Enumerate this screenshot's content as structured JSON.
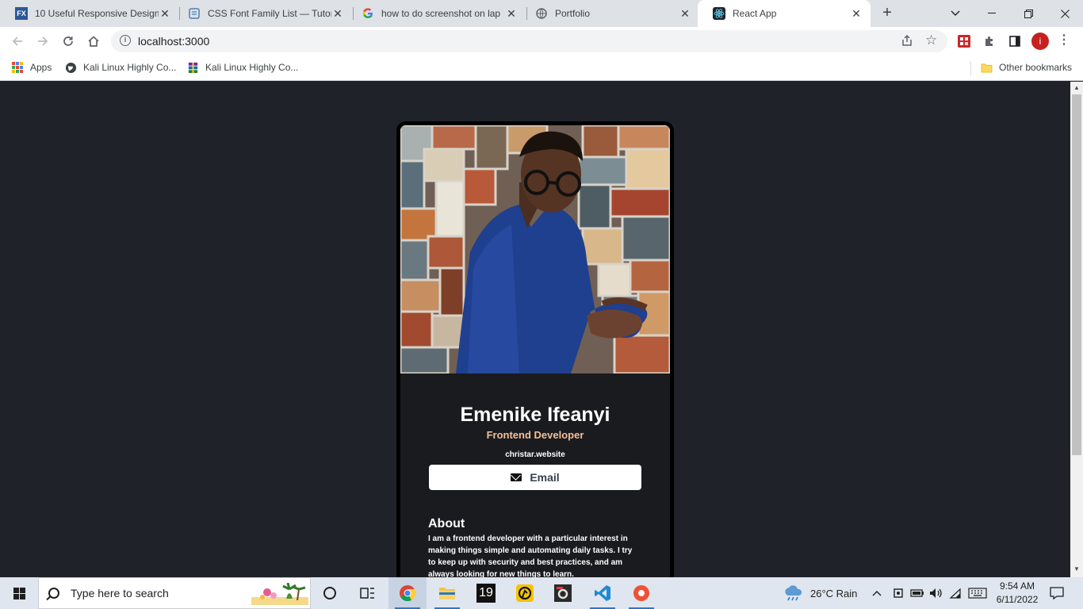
{
  "browser": {
    "tabs": [
      {
        "title": "10 Useful Responsive Design",
        "favicon": "fx-icon",
        "active": false
      },
      {
        "title": "CSS Font Family List — Tutor",
        "favicon": "css-tutorial-icon",
        "active": false
      },
      {
        "title": "how to do screenshot on lap",
        "favicon": "google-icon",
        "active": false
      },
      {
        "title": "Portfolio",
        "favicon": "globe-icon",
        "active": false
      },
      {
        "title": "React App",
        "favicon": "react-icon",
        "active": true
      }
    ],
    "url": "localhost:3000",
    "bookmarks": [
      {
        "label": "Apps",
        "icon": "apps-grid-icon"
      },
      {
        "label": "Kali Linux Highly Co...",
        "icon": "globe-icon"
      },
      {
        "label": "Kali Linux Highly Co...",
        "icon": "winrar-icon"
      }
    ],
    "other_bookmarks": "Other bookmarks",
    "profile_initial": "i"
  },
  "page": {
    "name": "Emenike Ifeanyi",
    "role": "Frontend Developer",
    "website": "christar.website",
    "email_button": "Email",
    "about_title": "About",
    "about_text": "I am a frontend developer with a particular interest in making things simple and automating daily tasks. I try to keep up with security and best practices, and am always looking for new things to learn."
  },
  "taskbar": {
    "search_placeholder": "Type here to search",
    "calendar_day": "19",
    "weather": "26°C  Rain",
    "time": "9:54 AM",
    "date": "6/11/2022"
  },
  "colors": {
    "page_bg": "#202229",
    "card_bg": "#1a1b1e",
    "role_accent": "#f3bf99"
  }
}
